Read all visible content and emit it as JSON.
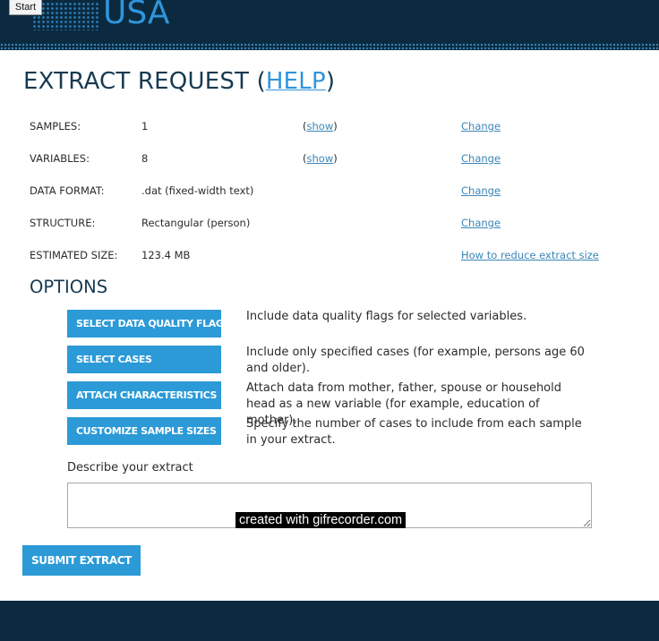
{
  "header": {
    "logo_text": "USA",
    "start_button": "Start"
  },
  "title": {
    "main": "EXTRACT REQUEST (",
    "help_link": "HELP",
    "close": ")"
  },
  "summary": {
    "samples": {
      "label": "SAMPLES:",
      "value": "1",
      "show_open": "(",
      "show_link": "show",
      "show_close": ")",
      "change": "Change"
    },
    "variables": {
      "label": "VARIABLES:",
      "value": "8",
      "show_open": "(",
      "show_link": "show",
      "show_close": ")",
      "change": "Change"
    },
    "data_format": {
      "label": "DATA FORMAT:",
      "value": ".dat (fixed-width text)",
      "change": "Change"
    },
    "structure": {
      "label": "STRUCTURE:",
      "value": "Rectangular (person)",
      "change": "Change"
    },
    "estimated_size": {
      "label": "ESTIMATED SIZE:",
      "value": "123.4 MB",
      "change": "How to reduce extract size"
    }
  },
  "options": {
    "title": "OPTIONS",
    "items": [
      {
        "button": "SELECT DATA QUALITY FLAGS",
        "description": "Include data quality flags for selected variables."
      },
      {
        "button": "SELECT CASES",
        "description": "Include only specified cases (for example, persons age 60 and older)."
      },
      {
        "button": "ATTACH CHARACTERISTICS",
        "description": "Attach data from mother, father, spouse or household head as a new variable (for example, education of mother)."
      },
      {
        "button": "CUSTOMIZE SAMPLE SIZES",
        "description": "Specify the number of cases to include from each sample in your extract."
      }
    ]
  },
  "describe": {
    "label": "Describe your extract",
    "value": ""
  },
  "watermark": "created with gifrecorder.com",
  "submit_label": "SUBMIT EXTRACT",
  "colors": {
    "header_bg": "#0b2a3f",
    "accent": "#2b9ad7",
    "link": "#3a86b6",
    "title": "#163a52"
  }
}
